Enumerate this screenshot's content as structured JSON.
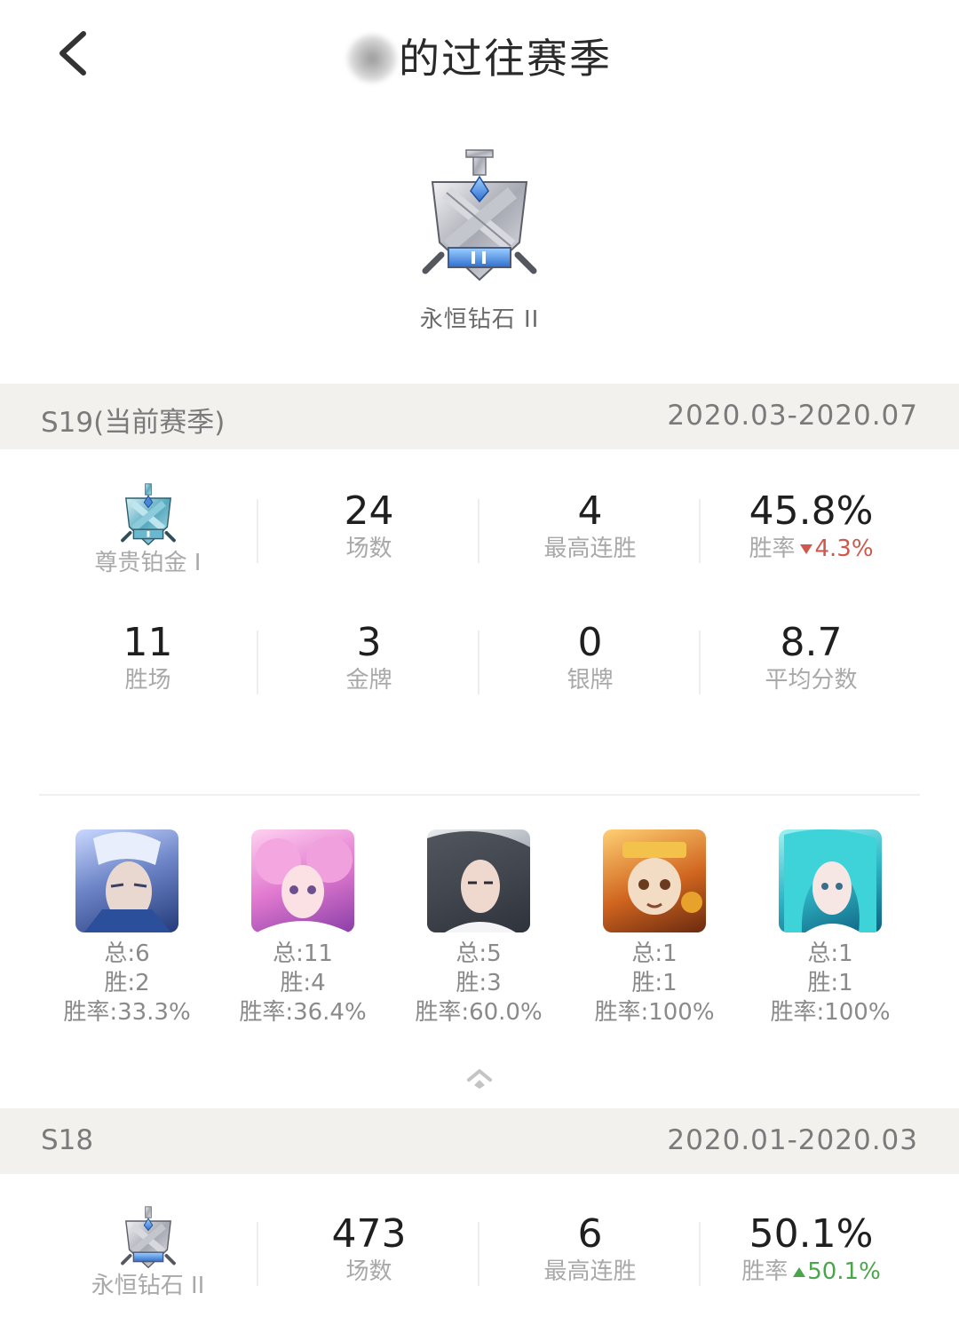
{
  "header": {
    "title": "的过往赛季"
  },
  "current_rank": {
    "label": "永恒钻石 II"
  },
  "seasons": [
    {
      "name": "S19(当前赛季)",
      "range": "2020.03-2020.07",
      "rank_label": "尊贵铂金 I",
      "games": "24",
      "games_label": "场数",
      "streak": "4",
      "streak_label": "最高连胜",
      "winrate": "45.8%",
      "winrate_label": "胜率",
      "winrate_delta": "4.3%",
      "winrate_trend": "down",
      "wins": "11",
      "wins_label": "胜场",
      "gold": "3",
      "gold_label": "金牌",
      "silver": "0",
      "silver_label": "银牌",
      "avg": "8.7",
      "avg_label": "平均分数",
      "heroes": [
        {
          "total": "总:6",
          "wins": "胜:2",
          "rate": "胜率:33.3%"
        },
        {
          "total": "总:11",
          "wins": "胜:4",
          "rate": "胜率:36.4%"
        },
        {
          "total": "总:5",
          "wins": "胜:3",
          "rate": "胜率:60.0%"
        },
        {
          "total": "总:1",
          "wins": "胜:1",
          "rate": "胜率:100%"
        },
        {
          "total": "总:1",
          "wins": "胜:1",
          "rate": "胜率:100%"
        }
      ]
    },
    {
      "name": "S18",
      "range": "2020.01-2020.03",
      "rank_label": "永恒钻石 II",
      "games": "473",
      "games_label": "场数",
      "streak": "6",
      "streak_label": "最高连胜",
      "winrate": "50.1%",
      "winrate_label": "胜率",
      "winrate_delta": "50.1%",
      "winrate_trend": "up"
    }
  ],
  "colors": {
    "delta_down": "#d0574b",
    "delta_up": "#4aa64a",
    "section_bg": "#f3f1ee"
  },
  "icons": [
    "back-icon",
    "diamond-rank-emblem",
    "platinum-rank-emblem",
    "collapse-chevron-icon"
  ]
}
